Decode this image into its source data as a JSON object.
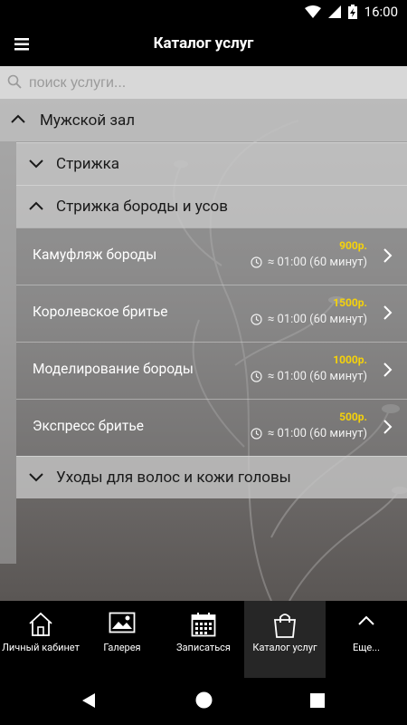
{
  "status": {
    "time": "16:00"
  },
  "appbar": {
    "title": "Каталог услуг"
  },
  "search": {
    "placeholder": "поиск услуги..."
  },
  "category": {
    "label": "Мужской зал"
  },
  "subcategories": [
    {
      "label": "Стрижка",
      "expanded": false
    },
    {
      "label": "Стрижка бороды и усов",
      "expanded": true
    },
    {
      "label": "Уходы для волос и кожи головы",
      "expanded": false
    }
  ],
  "services": [
    {
      "name": "Камуфляж бороды",
      "price": "900р.",
      "duration": "≈ 01:00 (60 минут)"
    },
    {
      "name": "Королевское бритье",
      "price": "1500р.",
      "duration": "≈ 01:00 (60 минут)"
    },
    {
      "name": "Моделирование бороды",
      "price": "1000р.",
      "duration": "≈ 01:00 (60 минут)"
    },
    {
      "name": "Экспресс бритье",
      "price": "500р.",
      "duration": "≈ 01:00 (60 минут)"
    }
  ],
  "nav": {
    "items": [
      {
        "label": "Личный кабинет",
        "icon": "home-icon"
      },
      {
        "label": "Галерея",
        "icon": "gallery-icon"
      },
      {
        "label": "Записаться",
        "icon": "calendar-icon"
      },
      {
        "label": "Каталог услуг",
        "icon": "shopping-bag-icon",
        "active": true
      },
      {
        "label": "Еще...",
        "icon": "chevron-up-icon"
      }
    ]
  },
  "colors": {
    "price": "#f5d20a",
    "bar": "#000000"
  }
}
